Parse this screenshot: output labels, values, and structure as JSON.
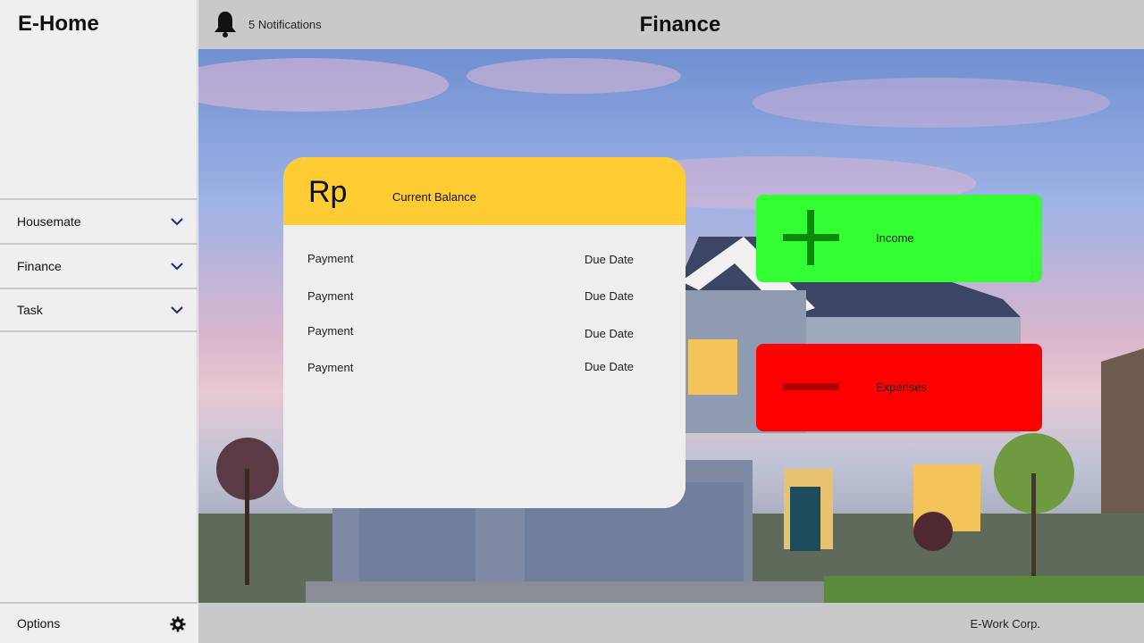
{
  "sidebar": {
    "brand": "E-Home",
    "items": [
      {
        "label": "Housemate"
      },
      {
        "label": "Finance"
      },
      {
        "label": "Task"
      }
    ],
    "options_label": "Options"
  },
  "header": {
    "notifications": "5 Notifications",
    "title": "Finance"
  },
  "balance": {
    "currency": "Rp",
    "label": "Current Balance",
    "rows": [
      {
        "payment": "Payment",
        "due": "Due Date"
      },
      {
        "payment": "Payment",
        "due": "Due Date"
      },
      {
        "payment": "Payment",
        "due": "Due Date"
      },
      {
        "payment": "Payment",
        "due": "Due Date"
      }
    ]
  },
  "actions": {
    "income": {
      "label": "Income",
      "icon": "plus-icon",
      "color": "#33ff33"
    },
    "expenses": {
      "label": "Expenses",
      "icon": "minus-icon",
      "color": "#ff0000"
    }
  },
  "footer": {
    "company": "E-Work Corp."
  },
  "colors": {
    "balance_header": "#ffcc33",
    "topbar": "#c9c9c9",
    "sidebar": "#efefef"
  }
}
